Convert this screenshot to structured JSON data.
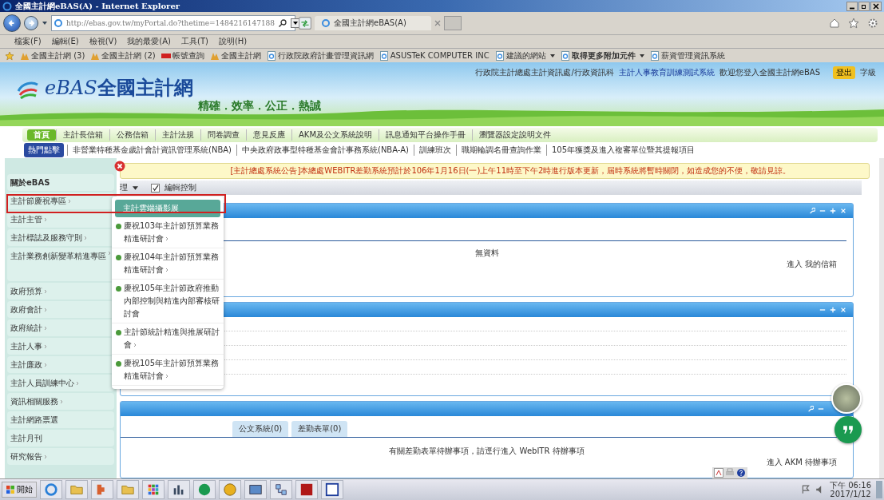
{
  "window": {
    "title": "全國主計網eBAS(A) - Internet Explorer"
  },
  "address_bar": {
    "url": "http://ebas.gov.tw/myPortal.do?thetime=1484216147188"
  },
  "tabs": [
    {
      "label": "全國主計網eBAS(A)",
      "selected": true
    }
  ],
  "menu_bar": [
    "檔案(F)",
    "編輯(E)",
    "檢視(V)",
    "我的最愛(A)",
    "工具(T)",
    "說明(H)"
  ],
  "favorites_bar": [
    {
      "label": "全國主計網 (3)",
      "kind": "site",
      "dropdown": false,
      "emphasized": false
    },
    {
      "label": "全國主計網 (2)",
      "kind": "site",
      "dropdown": false,
      "emphasized": false
    },
    {
      "label": "帳號查詢",
      "kind": "tool",
      "dropdown": false,
      "emphasized": false
    },
    {
      "label": "全國主計網",
      "kind": "site",
      "dropdown": false,
      "emphasized": false
    },
    {
      "label": "行政院政府計畫管理資訊網",
      "kind": "page",
      "dropdown": false,
      "emphasized": false
    },
    {
      "label": "ASUSTeK COMPUTER INC",
      "kind": "page",
      "dropdown": false,
      "emphasized": false
    },
    {
      "label": "建議的網站",
      "kind": "page",
      "dropdown": true,
      "emphasized": false
    },
    {
      "label": "取得更多附加元件",
      "kind": "page",
      "dropdown": true,
      "emphasized": true
    },
    {
      "label": "薪資管理資訊系統",
      "kind": "page",
      "dropdown": false,
      "emphasized": false
    }
  ],
  "banner": {
    "logo_latin": "eBAS",
    "logo_text": "全國主計網",
    "slogan": "精確．效率．公正．熱誠",
    "top_links": [
      {
        "text": "行政院主計總處主計資訊處/行政資訊科",
        "kind": "text"
      },
      {
        "text": "主計人事教育訓練測試系統",
        "kind": "link"
      },
      {
        "text": "歡迎您登入全國主計網eBAS",
        "kind": "text"
      }
    ],
    "logout": "登出",
    "font_size": "字級"
  },
  "nav": [
    {
      "label": "首頁",
      "selected": true
    },
    {
      "label": "主計長信箱",
      "selected": false
    },
    {
      "label": "公務信箱",
      "selected": false
    },
    {
      "label": "主計法規",
      "selected": false
    },
    {
      "label": "問卷調查",
      "selected": false
    },
    {
      "label": "意見反應",
      "selected": false
    },
    {
      "label": "AKM及公文系統說明",
      "selected": false
    },
    {
      "label": "訊息通知平台操作手冊",
      "selected": false
    },
    {
      "label": "瀏覽器設定說明文件",
      "selected": false
    }
  ],
  "hot_links": {
    "label": "熱門點擊",
    "items": [
      "非營業特種基金歲計會計資訊管理系統(NBA)",
      "中央政府政事型特種基金會計事務系統(NBA-A)",
      "訓練班次",
      "職期輪調名冊查詢作業",
      "105年獲獎及進入複審單位暨其提報項目"
    ]
  },
  "sidebar": [
    {
      "label": "關於eBAS",
      "has_submenu": false
    },
    {
      "label": "主計節慶祝專區",
      "has_submenu": true
    },
    {
      "label": "主計主管",
      "has_submenu": true
    },
    {
      "label": "主計標誌及服務守則",
      "has_submenu": true
    },
    {
      "label": "主計業務創新變革精進專區",
      "has_submenu": true
    },
    {
      "label": "政府預算",
      "has_submenu": true
    },
    {
      "label": "政府會計",
      "has_submenu": true
    },
    {
      "label": "政府統計",
      "has_submenu": true
    },
    {
      "label": "主計人事",
      "has_submenu": true
    },
    {
      "label": "主計廉政",
      "has_submenu": true
    },
    {
      "label": "主計人員訓練中心",
      "has_submenu": true
    },
    {
      "label": "資訊相關服務",
      "has_submenu": true
    },
    {
      "label": "主計網路票選",
      "has_submenu": false
    },
    {
      "label": "主計月刊",
      "has_submenu": false
    },
    {
      "label": "研究報告",
      "has_submenu": true
    }
  ],
  "submenu": {
    "title": "主計雲端攝影展",
    "items": [
      {
        "label": "慶祝103年主計節預算業務精進研討會",
        "has_submenu": true
      },
      {
        "label": "慶祝104年主計節預算業務精進研討會",
        "has_submenu": true
      },
      {
        "label": "慶祝105年主計節政府推動內部控制與精進內部審核研討會",
        "has_submenu": false
      },
      {
        "label": "主計節統計精進與推展研討會",
        "has_submenu": true
      },
      {
        "label": "慶祝105年主計節預算業務精進研討會",
        "has_submenu": true
      }
    ]
  },
  "notice": "[主計總處系統公告]本總處WEBITR差勤系統預計於106年1月16日(一)上午11時至下午2時進行版本更新，屆時系統將暫時關閉，如造成您的不便，敬請見諒。",
  "toolbar": {
    "manage": "理",
    "edit_control": {
      "label": "編輯控制",
      "checked": true
    }
  },
  "panels": [
    {
      "kind": "mail",
      "configurable": true,
      "empty_text": "無資料",
      "link": "進入 我的信箱"
    },
    {
      "kind": "list",
      "configurable": false
    },
    {
      "kind": "todo",
      "configurable": true,
      "tabs": [
        {
          "label": "公文系統(0)"
        },
        {
          "label": "差勤表單(0)"
        }
      ],
      "message": "有關差勤表單待辦事項，請逕行進入 WebITR 待辦事項",
      "link": "進入 AKM 待辦事項"
    }
  ],
  "taskbar": {
    "start": "開始",
    "time": "下午 06:16",
    "date": "2017/1/12"
  }
}
